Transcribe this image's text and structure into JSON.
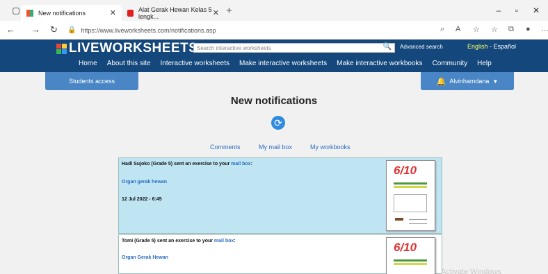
{
  "browser": {
    "tabs": [
      {
        "label": "New notifications",
        "active": true
      },
      {
        "label": "Alat Gerak Hewan Kelas 5 lengk...",
        "active": false
      }
    ],
    "url": "https://www.liveworksheets.com/notifications.asp"
  },
  "site": {
    "logo": "LIVEWORKSHEETS",
    "search_placeholder": "Search interactive worksheets",
    "advanced_search": "Advanced search",
    "lang_en": "English",
    "lang_sep": " - ",
    "lang_es": "Español",
    "menu": [
      "Home",
      "About this site",
      "Interactive worksheets",
      "Make interactive worksheets",
      "Make interactive workbooks",
      "Community",
      "Help"
    ],
    "students_access": "Students access",
    "username": "Alvinhamdana"
  },
  "page": {
    "title": "New notifications",
    "links": {
      "comments": "Comments",
      "mailbox": "My mail box",
      "workbooks": "My workbooks"
    }
  },
  "notifications": [
    {
      "sender_text": "Hadi Sujoko (Grade 5) sent an exercise to your ",
      "link": "mail box",
      "suffix": ":",
      "worksheet": "Organ gerak hewan",
      "date": "12 Jul 2022 - 6:45",
      "thumb_grade": "6/10"
    },
    {
      "sender_text": "Tomi (Grade 5) sent an exercise to your ",
      "link": "mail box",
      "suffix": ":",
      "worksheet": "Organ Gerak Hewan",
      "thumb_grade": "6/10"
    }
  ],
  "os_watermark": "Activate Windows",
  "colors": {
    "header": "#14477b",
    "button": "#4a86c5",
    "highlight": "#bfe4f2",
    "link": "#2a6cc0"
  }
}
